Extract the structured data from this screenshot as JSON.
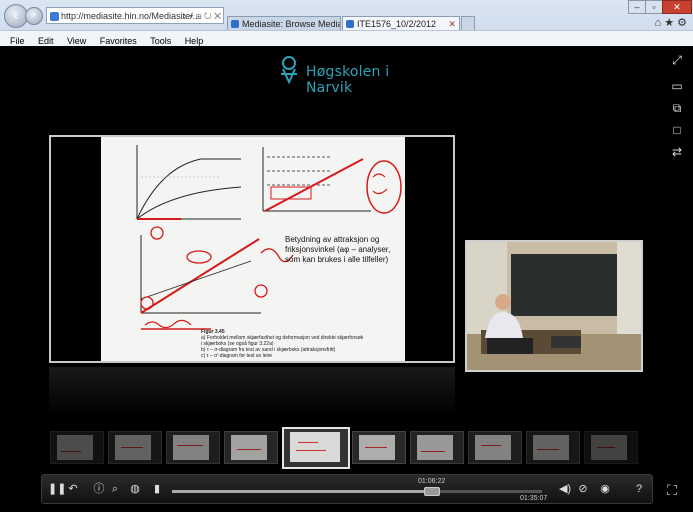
{
  "browser": {
    "address": "http://mediasite.hin.no/Mediasite/...",
    "tabs": [
      {
        "label": "Mediasite: Browse Mediasite"
      },
      {
        "label": "ITE1576_10/2/2012"
      }
    ],
    "menu": [
      "File",
      "Edit",
      "View",
      "Favorites",
      "Tools",
      "Help"
    ]
  },
  "player": {
    "logo_text": "Høgskolen i Narvik",
    "slide": {
      "body_text": "Betydning av attraksjon og friksjonsvinkel (aφ – analyser, som kan brukes i alle tilfeller)",
      "caption_lines": [
        "Figur 3.45",
        "a)  Forholdet mellom skjærfasthet og deformasjon ved direkte skjærforsøk",
        "     i skjærboks (se også figur 3.22a)",
        "b)  τ – σ-diagram fra test av sand i skjærboks (attraksjonsfritt)",
        "c)  τ – σ'-diagram for test av leire"
      ]
    },
    "current_time": "01:06:22",
    "total_time": "01:35:07",
    "progress": 0.7
  },
  "colors": {
    "accent": "#2aa2b8",
    "annotation_red": "#d41a1a"
  }
}
